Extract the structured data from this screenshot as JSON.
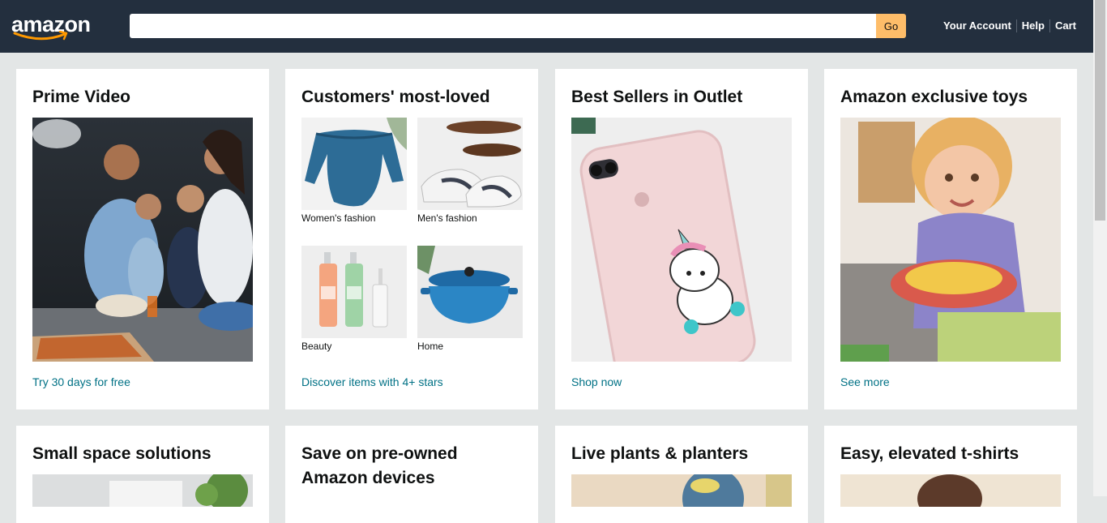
{
  "header": {
    "logo_text": "amazon",
    "search_placeholder": "",
    "search_value": "",
    "go_label": "Go",
    "links": [
      "Your Account",
      "Help",
      "Cart"
    ]
  },
  "colors": {
    "header_bg": "#232f3e",
    "go_button": "#febd69",
    "link": "#007185",
    "page_bg": "#e3e6e6"
  },
  "cards": [
    {
      "title": "Prime Video",
      "image": "family-watching-movie-image",
      "link": "Try 30 days for free"
    },
    {
      "title": "Customers' most-loved",
      "items": [
        {
          "label": "Women's fashion",
          "image": "blue-top-image"
        },
        {
          "label": "Men's fashion",
          "image": "shoes-image"
        },
        {
          "label": "Beauty",
          "image": "beauty-bottles-image"
        },
        {
          "label": "Home",
          "image": "blue-pot-image"
        }
      ],
      "link": "Discover items with 4+ stars"
    },
    {
      "title": "Best Sellers in Outlet",
      "image": "unicorn-phone-case-image",
      "link": "Shop now"
    },
    {
      "title": "Amazon exclusive toys",
      "image": "toddler-toy-image",
      "link": "See more"
    },
    {
      "title": "Small space solutions"
    },
    {
      "title": "Save on pre-owned Amazon devices"
    },
    {
      "title": "Live plants & planters"
    },
    {
      "title": "Easy, elevated t-shirts"
    }
  ]
}
